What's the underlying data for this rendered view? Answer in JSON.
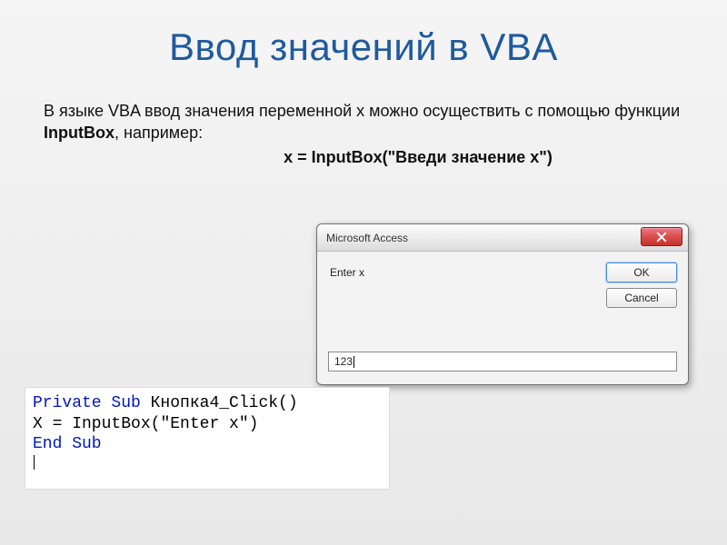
{
  "title": "Ввод значений в VBA",
  "desc_pre": "В языке VBA ввод значения переменной x можно осуществить с помощью функции ",
  "desc_bold": "InputBox",
  "desc_post": ", например:",
  "example": "x = InputBox(\"Введи значение x\")",
  "dialog": {
    "title": "Microsoft Access",
    "prompt": "Enter x",
    "ok": "OK",
    "cancel": "Cancel",
    "input_value": "123"
  },
  "code": {
    "kw1": "Private Sub",
    "name": " Кнопка4_Click()",
    "line2_pre": "X = InputBox(",
    "line2_str": "\"Enter x\"",
    "line2_post": ")",
    "kw3": "End Sub"
  }
}
